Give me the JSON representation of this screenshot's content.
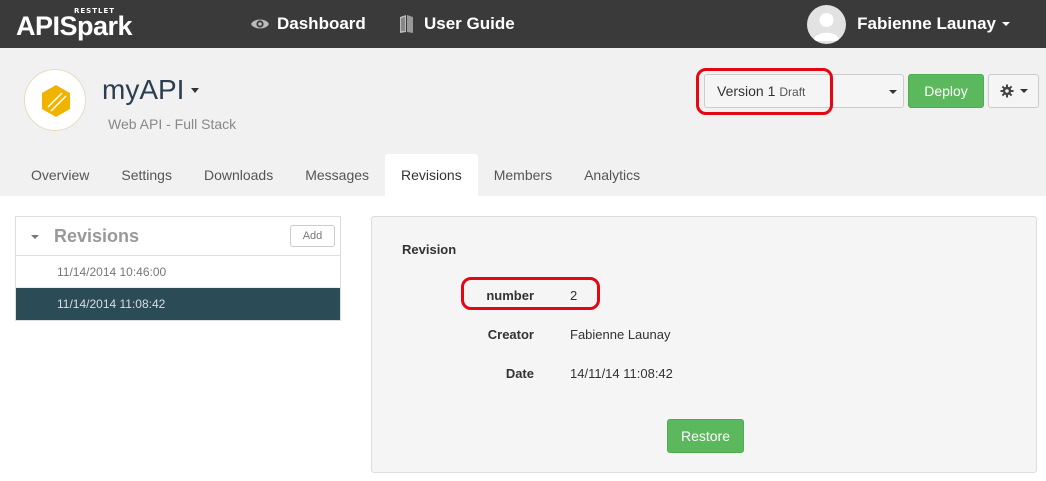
{
  "topbar": {
    "logo": {
      "small_text": "RESTLET",
      "brand_text": "APISpark"
    },
    "nav": [
      {
        "label": "Dashboard",
        "icon": "eye-icon"
      },
      {
        "label": "User Guide",
        "icon": "book-icon"
      }
    ],
    "user": {
      "name": "Fabienne Launay"
    }
  },
  "header": {
    "api_name": "myAPI",
    "api_subtitle": "Web API - Full Stack",
    "version": {
      "label": "Version 1",
      "status": "Draft"
    },
    "deploy_label": "Deploy",
    "tabs": [
      {
        "label": "Overview"
      },
      {
        "label": "Settings"
      },
      {
        "label": "Downloads"
      },
      {
        "label": "Messages"
      },
      {
        "label": "Revisions"
      },
      {
        "label": "Members"
      },
      {
        "label": "Analytics"
      }
    ],
    "active_tab": "Revisions"
  },
  "revisions_panel": {
    "title": "Revisions",
    "add_label": "Add",
    "items": [
      {
        "label": "11/14/2014 10:46:00"
      },
      {
        "label": "11/14/2014 11:08:42"
      }
    ],
    "selected_index": 1
  },
  "revision_detail": {
    "heading": "Revision",
    "fields": [
      {
        "label": "number",
        "value": "2"
      },
      {
        "label": "Creator",
        "value": "Fabienne Launay"
      },
      {
        "label": "Date",
        "value": "14/11/14 11:08:42"
      }
    ],
    "restore_label": "Restore"
  },
  "colors": {
    "topbar_bg": "#3a3a3a",
    "header_bg": "#f1f1f1",
    "success_green": "#5cb85c",
    "selected_row": "#2b4b57",
    "highlight_red": "#e30613",
    "api_logo_yellow": "#f0b400"
  }
}
